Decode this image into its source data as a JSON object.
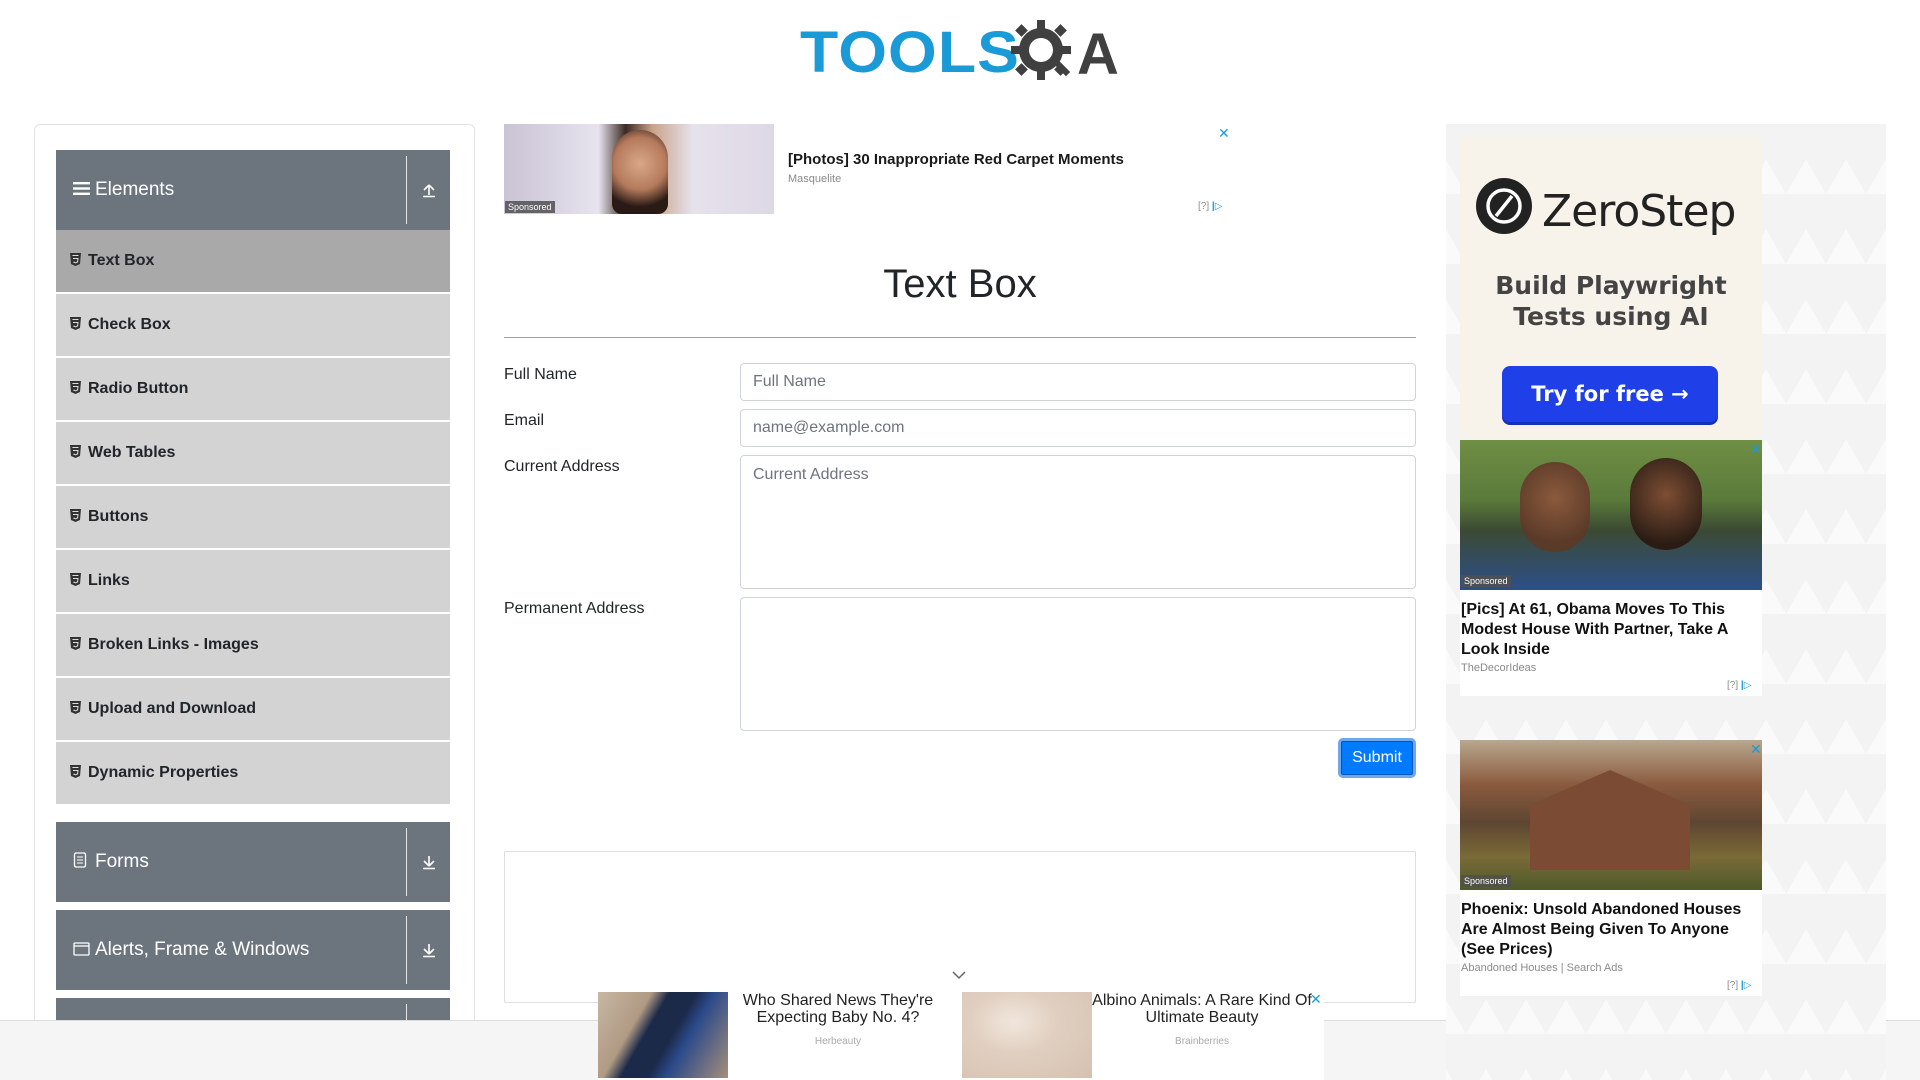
{
  "header": {
    "logo_text_tools": "TOOLS",
    "logo_text_a": "A",
    "logo_alt": "TOOLSQA"
  },
  "sidebar": {
    "groups": [
      {
        "title": "Elements",
        "icon": "hamburger-icon",
        "toggle_icon": "collapse-up-icon",
        "expanded": true
      },
      {
        "title": "Forms",
        "icon": "document-icon",
        "toggle_icon": "expand-down-icon",
        "expanded": false
      },
      {
        "title": "Alerts, Frame & Windows",
        "icon": "window-icon",
        "toggle_icon": "expand-down-icon",
        "expanded": false
      }
    ],
    "items": [
      {
        "label": "Text Box",
        "active": true
      },
      {
        "label": "Check Box",
        "active": false
      },
      {
        "label": "Radio Button",
        "active": false
      },
      {
        "label": "Web Tables",
        "active": false
      },
      {
        "label": "Buttons",
        "active": false
      },
      {
        "label": "Links",
        "active": false
      },
      {
        "label": "Broken Links - Images",
        "active": false
      },
      {
        "label": "Upload and Download",
        "active": false
      },
      {
        "label": "Dynamic Properties",
        "active": false
      }
    ]
  },
  "top_ad": {
    "title": "[Photos] 30 Inappropriate Red Carpet Moments",
    "source": "Masquelite",
    "sponsored": "Sponsored",
    "close": "✕",
    "choices": "[?]"
  },
  "main": {
    "title": "Text Box",
    "fields": {
      "full_name": {
        "label": "Full Name",
        "placeholder": "Full Name",
        "value": ""
      },
      "email": {
        "label": "Email",
        "placeholder": "name@example.com",
        "value": ""
      },
      "current_address": {
        "label": "Current Address",
        "placeholder": "Current Address",
        "value": ""
      },
      "permanent_address": {
        "label": "Permanent Address",
        "placeholder": "",
        "value": ""
      }
    },
    "submit_label": "Submit"
  },
  "bottom_ad": {
    "cards": [
      {
        "title": "Who Shared News They're Expecting Baby No. 4?",
        "source": "Herbeauty"
      },
      {
        "title": "Albino Animals: A Rare Kind Of Ultimate Beauty",
        "source": "Brainberries"
      }
    ],
    "close": "✕"
  },
  "right_ads": {
    "zerostep": {
      "brand": "ZeroStep",
      "tagline": "Build Playwright Tests using AI",
      "cta": "Try for free →"
    },
    "cards": [
      {
        "title": "[Pics] At 61, Obama Moves To This Modest House With Partner, Take A Look Inside",
        "source": "TheDecorIdeas",
        "sponsored": "Sponsored"
      },
      {
        "title": "Phoenix: Unsold Abandoned Houses Are Almost Being Given To Anyone (See Prices)",
        "source": "Abandoned Houses | Search Ads",
        "sponsored": "Sponsored"
      }
    ],
    "choices": "[?]"
  },
  "colors": {
    "brand_blue": "#1a9bd7",
    "sidebar_header": "#6c757d",
    "sidebar_item": "#d3d3d3",
    "sidebar_item_active": "#a9a9a9",
    "submit": "#007bff"
  }
}
